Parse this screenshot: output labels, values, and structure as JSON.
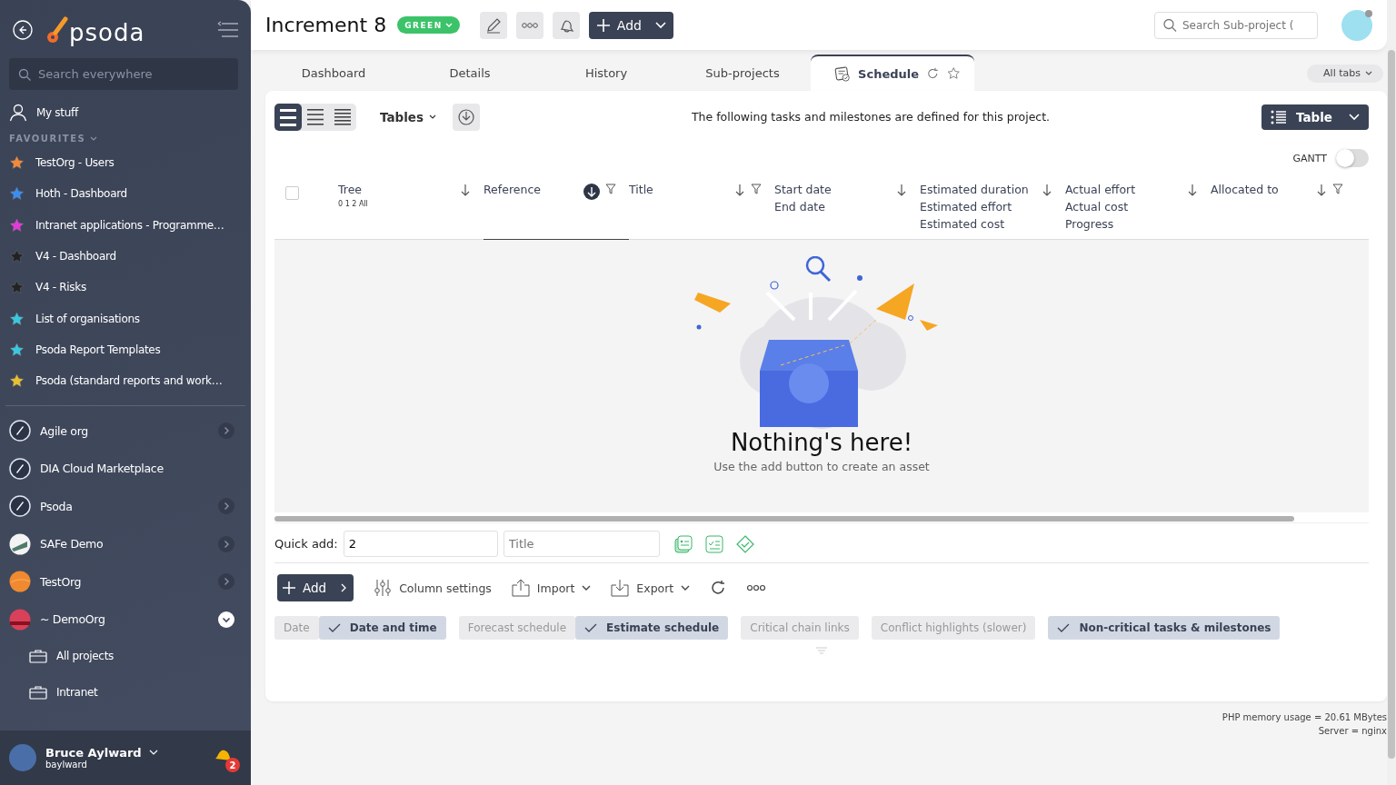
{
  "sidebar": {
    "logo": "psoda",
    "search": {
      "placeholder": "Search everywhere"
    },
    "my_stuff": "My stuff",
    "favourites_heading": "FAVOURITES",
    "favourites": [
      {
        "label": "TestOrg - Users",
        "color": "#f38a3a"
      },
      {
        "label": "Hoth - Dashboard",
        "color": "#3a8ef0"
      },
      {
        "label": "Intranet applications - Programme…",
        "color": "#e23ad8"
      },
      {
        "label": "V4 - Dashboard",
        "color": "#222222"
      },
      {
        "label": "V4 - Risks",
        "color": "#222222"
      },
      {
        "label": "List of organisations",
        "color": "#3ac8e0"
      },
      {
        "label": "Psoda Report Templates",
        "color": "#3ac8e0"
      },
      {
        "label": "Psoda (standard reports and work…",
        "color": "#e8c030"
      }
    ],
    "organisations": [
      {
        "label": "Agile org",
        "kind": "rocket",
        "expandable": true,
        "expanded": false
      },
      {
        "label": "DIA Cloud Marketplace",
        "kind": "rocket",
        "expandable": false,
        "expanded": false
      },
      {
        "label": "Psoda",
        "kind": "rocket",
        "expandable": true,
        "expanded": false
      },
      {
        "label": "SAFe Demo",
        "kind": "stripes",
        "expandable": true,
        "expanded": false
      },
      {
        "label": "TestOrg",
        "kind": "orange",
        "expandable": true,
        "expanded": false
      },
      {
        "label": "~ DemoOrg",
        "kind": "sunset",
        "expandable": true,
        "expanded": true,
        "children": [
          {
            "label": "All projects"
          },
          {
            "label": "Intranet"
          }
        ]
      }
    ],
    "user": {
      "name": "Bruce Aylward",
      "username": "baylward",
      "notifications": "2"
    }
  },
  "header": {
    "title": "Increment 8",
    "status": "GREEN",
    "add": "Add",
    "search": {
      "placeholder": "Search Sub-project ("
    }
  },
  "tabs": [
    {
      "label": "Dashboard",
      "selected": false
    },
    {
      "label": "Details",
      "selected": false
    },
    {
      "label": "History",
      "selected": false
    },
    {
      "label": "Sub-projects",
      "selected": false
    },
    {
      "label": "Schedule",
      "selected": true
    }
  ],
  "all_tabs": "All tabs",
  "toolbar": {
    "densities": [
      {
        "selected": true
      },
      {
        "selected": false
      },
      {
        "selected": false
      }
    ],
    "tables": "Tables",
    "description": "The following tasks and milestones are defined for this project.",
    "view": "Table",
    "gantt": {
      "label": "GANTT",
      "on": false
    }
  },
  "table": {
    "select_all": {
      "checked": false
    },
    "columns": [
      {
        "lines": [
          "Tree"
        ],
        "levels": "0 1 2 All",
        "sorted": false,
        "filter": false
      },
      {
        "lines": [
          "Reference"
        ],
        "sorted": true,
        "filter": true
      },
      {
        "lines": [
          "Title"
        ],
        "sorted": false,
        "filter": true
      },
      {
        "lines": [
          "Start date",
          "End date"
        ],
        "sorted": false,
        "filter": false
      },
      {
        "lines": [
          "Estimated duration",
          "Estimated effort",
          "Estimated cost"
        ],
        "sorted": false,
        "filter": false
      },
      {
        "lines": [
          "Actual effort",
          "Actual cost",
          "Progress"
        ],
        "sorted": false,
        "filter": false
      },
      {
        "lines": [
          "Allocated to"
        ],
        "sorted": false,
        "filter": true
      }
    ],
    "empty": {
      "title": "Nothing's here!",
      "subtitle": "Use the add button to create an asset"
    }
  },
  "quick_add": {
    "label": "Quick add:",
    "value": "2",
    "placeholder": "Title"
  },
  "actions": {
    "add": "Add",
    "column_settings": "Column settings",
    "import": "Import",
    "export": "Export"
  },
  "options": [
    [
      {
        "label": "Date",
        "selected": false
      },
      {
        "label": "Date and time",
        "selected": true
      }
    ],
    [
      {
        "label": "Forecast schedule",
        "selected": false
      },
      {
        "label": "Estimate schedule",
        "selected": true
      }
    ],
    [
      {
        "label": "Critical chain links",
        "selected": false
      }
    ],
    [
      {
        "label": "Conflict highlights (slower)",
        "selected": false
      }
    ],
    [
      {
        "label": "Non-critical tasks & milestones",
        "selected": true
      }
    ]
  ],
  "footer": [
    "PHP memory usage = 20.61 MBytes",
    "Server = nginx"
  ]
}
